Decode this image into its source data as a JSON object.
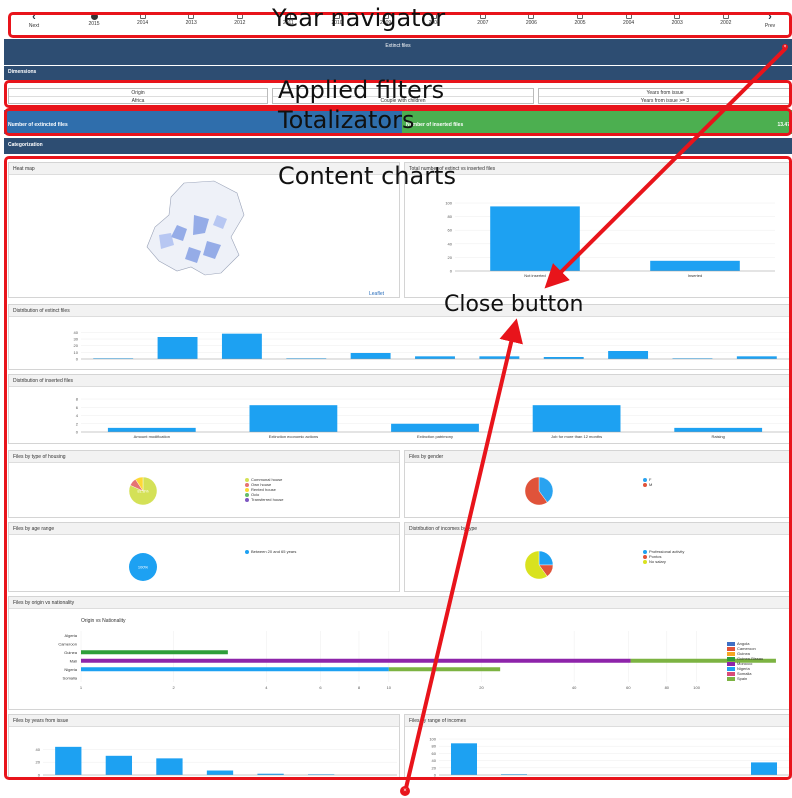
{
  "annotations": {
    "year_navigator": "Year navigator",
    "applied_filters": "Applied filters",
    "totalizators": "Totalizators",
    "content_charts": "Content charts",
    "close_button": "Close button"
  },
  "nav": {
    "next": "Next",
    "prev": "Prev",
    "years": [
      "2015",
      "2014",
      "2013",
      "2012",
      "2011",
      "2010",
      "2009",
      "2008",
      "2007",
      "2006",
      "2005",
      "2004",
      "2003",
      "2002"
    ]
  },
  "header": {
    "title": "Extinct files"
  },
  "filters": {
    "section_title": "Dimensions",
    "items": [
      {
        "label": "Origin",
        "value": "Africa"
      },
      {
        "label": "",
        "value": "Couple with children"
      },
      {
        "label": "Years from issue",
        "value": "Years from issue >= 3"
      }
    ]
  },
  "totals": {
    "extinct_label": "Number of extincted files",
    "inserted_label": "Number of inserted files",
    "inserted_value": "13.47"
  },
  "sections": {
    "categorization": "Categorization"
  },
  "panels": {
    "heatmap": {
      "title": "Heat map",
      "attribution": "Leaflet"
    },
    "total_extinct_vs_inserted": {
      "title": "Total number of extinct vs inserted files"
    },
    "distribution_extinct": {
      "title": "Distribution of extinct files"
    },
    "distribution_inserted": {
      "title": "Distribution of inserted files"
    },
    "housing": {
      "title": "Files by type of housing",
      "center_label": "81.8%"
    },
    "gender": {
      "title": "Files by gender"
    },
    "age": {
      "title": "Files by age range",
      "center_label": "100%"
    },
    "incomes_type": {
      "title": "Distribution of incomes by type"
    },
    "origin_nationality": {
      "title": "Files by origin vs nationality",
      "chart_title": "Origin vs Nationality"
    },
    "years_issue": {
      "title": "Files by years from issue"
    },
    "range_incomes": {
      "title": "Files by range of incomes"
    }
  },
  "colors": {
    "bar": "#1da1f2",
    "header": "#2d4d72",
    "inserted_total": "#4caf50",
    "highlight": "#e8141b"
  },
  "chart_data": [
    {
      "type": "bar",
      "title": "Total number of extinct vs inserted files",
      "categories": [
        "Not inserted",
        "Inserted"
      ],
      "values": [
        95,
        15
      ],
      "yticks": [
        0,
        20,
        40,
        60,
        80,
        100
      ],
      "ylim": [
        0,
        100
      ]
    },
    {
      "type": "bar",
      "title": "Distribution of extinct files",
      "categories": [
        "",
        "",
        "",
        "",
        "",
        "",
        "",
        "",
        "",
        "",
        ""
      ],
      "values": [
        1,
        33,
        38,
        1,
        9,
        4,
        4,
        3,
        12,
        1,
        4
      ],
      "yticks": [
        0,
        10,
        20,
        30,
        40
      ],
      "ylim": [
        0,
        45
      ]
    },
    {
      "type": "bar",
      "title": "Distribution of inserted files",
      "categories": [
        "Amount modification",
        "Extinction economic actions",
        "Extinction patrimony",
        "Job for more than 12 months",
        "Raising"
      ],
      "values": [
        1,
        6.5,
        2,
        6.5,
        1
      ],
      "yticks": [
        0,
        2,
        4,
        6,
        8
      ],
      "ylim": [
        0,
        8
      ]
    },
    {
      "type": "pie",
      "title": "Files by type of housing",
      "labels": [
        "Communal house",
        "Own house",
        "Rented house",
        "Ocio",
        "Transferred house"
      ],
      "values": [
        81.8,
        9.1,
        9.1,
        0,
        0
      ],
      "colors": [
        "#d4e157",
        "#e57373",
        "#fdd835",
        "#66bb6a",
        "#7e57c2"
      ]
    },
    {
      "type": "pie",
      "title": "Files by gender",
      "labels": [
        "F",
        "M"
      ],
      "values": [
        40,
        60
      ],
      "colors": [
        "#29a3f0",
        "#e0533a"
      ]
    },
    {
      "type": "pie",
      "title": "Files by age range",
      "labels": [
        "Between 20 and 65 years"
      ],
      "values": [
        100
      ],
      "colors": [
        "#1da1f2"
      ]
    },
    {
      "type": "pie",
      "title": "Distribution of incomes by type",
      "labels": [
        "Professional activity",
        "Pontos",
        "No salary"
      ],
      "values": [
        25,
        15,
        60
      ],
      "colors": [
        "#1da1f2",
        "#e0533a",
        "#d9e21f"
      ]
    },
    {
      "type": "bar",
      "title": "Origin vs Nationality",
      "orientation": "horizontal",
      "xscale": "log",
      "categories": [
        "Algeria",
        "Cameroon",
        "Guinea",
        "Mali",
        "Nigeria",
        "Somalia"
      ],
      "xticks": [
        1,
        2,
        4,
        6,
        8,
        10,
        20,
        40,
        60,
        80,
        100
      ],
      "series": [
        {
          "name": "Angola",
          "color": "#3f6fc4",
          "values": [
            0,
            0,
            0,
            0,
            0,
            0
          ]
        },
        {
          "name": "Cameroon",
          "color": "#e0533a",
          "values": [
            0,
            0,
            0,
            0,
            0,
            0
          ]
        },
        {
          "name": "Guinea",
          "color": "#f5a623",
          "values": [
            0,
            0,
            0,
            0,
            0,
            0
          ]
        },
        {
          "name": "Guinea-Bissau",
          "color": "#2e9e3a",
          "values": [
            0,
            0,
            2,
            0,
            0,
            0
          ]
        },
        {
          "name": "Morocco",
          "color": "#8e24aa",
          "values": [
            0,
            0,
            0,
            60,
            0,
            0
          ]
        },
        {
          "name": "Nigeria",
          "color": "#1da1f2",
          "values": [
            0,
            0,
            0,
            0,
            9,
            0
          ]
        },
        {
          "name": "Somalia",
          "color": "#d84b7a",
          "values": [
            0,
            0,
            0,
            0,
            0,
            0
          ]
        },
        {
          "name": "Spain",
          "color": "#7cb342",
          "values": [
            0,
            0,
            0,
            120,
            13,
            0
          ]
        }
      ]
    },
    {
      "type": "bar",
      "title": "Files by years from issue",
      "categories": [
        "",
        "",
        "",
        "",
        "",
        "",
        ""
      ],
      "values": [
        44,
        30,
        26,
        7,
        2,
        1,
        0
      ],
      "yticks": [
        0,
        20,
        40
      ],
      "ylim": [
        0,
        50
      ]
    },
    {
      "type": "bar",
      "title": "Files by range of incomes",
      "categories": [
        "",
        "",
        "",
        "",
        "",
        "",
        ""
      ],
      "values": [
        88,
        2,
        0,
        0,
        0,
        0,
        35
      ],
      "yticks": [
        0,
        20,
        40,
        60,
        80,
        100
      ],
      "ylim": [
        0,
        100
      ]
    }
  ]
}
